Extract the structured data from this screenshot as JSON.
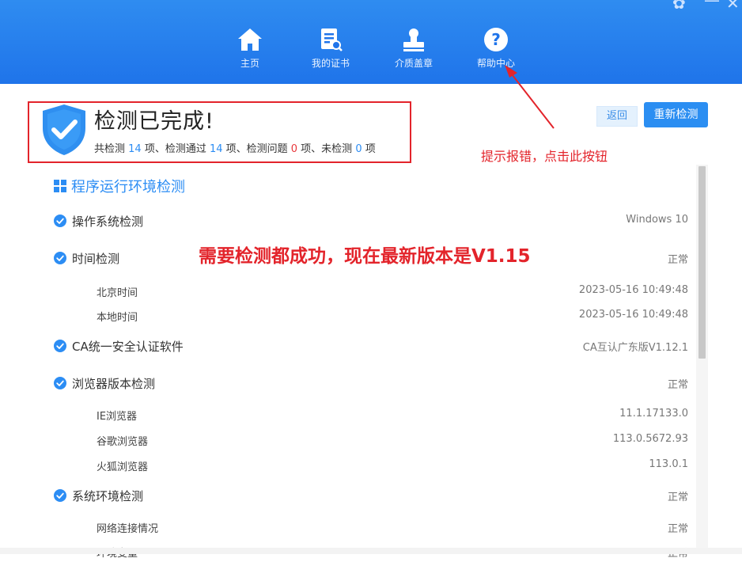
{
  "window": {
    "skin_icon": "skin-icon",
    "minimize_icon": "minimize-icon",
    "close_icon": "close-icon"
  },
  "nav": {
    "items": [
      {
        "label": "主页",
        "icon": "home-icon"
      },
      {
        "label": "我的证书",
        "icon": "certificate-icon"
      },
      {
        "label": "介质盖章",
        "icon": "stamp-icon"
      },
      {
        "label": "帮助中心",
        "icon": "help-icon"
      }
    ]
  },
  "result": {
    "title": "检测已完成!",
    "summary": {
      "p1": "共检测 ",
      "total": "14",
      "p2": " 项、检测通过 ",
      "passed": "14",
      "p3": " 项、检测问题 ",
      "issues": "0",
      "p4": " 项、未检测 ",
      "unchecked": "0",
      "p5": " 项"
    }
  },
  "buttons": {
    "back": "返回",
    "recheck": "重新检测"
  },
  "annotations": {
    "help_tip": "提示报错，点击此按钮",
    "version_note": "需要检测都成功，现在最新版本是V1.15"
  },
  "section": {
    "title": "程序运行环境检测"
  },
  "checks": [
    {
      "name": "操作系统检测",
      "value": "Windows 10",
      "main": true
    },
    {
      "name": "时间检测",
      "value": "正常",
      "main": true
    },
    {
      "name": "北京时间",
      "value": "2023-05-16 10:49:48",
      "main": false
    },
    {
      "name": "本地时间",
      "value": "2023-05-16 10:49:48",
      "main": false
    },
    {
      "name": "CA统一安全认证软件",
      "value": "CA互认广东版V1.12.1",
      "main": true
    },
    {
      "name": "浏览器版本检测",
      "value": "正常",
      "main": true
    },
    {
      "name": "IE浏览器",
      "value": "11.1.17133.0",
      "main": false
    },
    {
      "name": "谷歌浏览器",
      "value": "113.0.5672.93",
      "main": false
    },
    {
      "name": "火狐浏览器",
      "value": "113.0.1",
      "main": false
    },
    {
      "name": "系统环境检测",
      "value": "正常",
      "main": true
    },
    {
      "name": "网络连接情况",
      "value": "正常",
      "main": false
    },
    {
      "name": "环境变量",
      "value": "正常",
      "main": false
    }
  ],
  "colors": {
    "header_blue": "#1f74ea",
    "accent_blue": "#2c8df4",
    "alert_red": "#e3242b"
  }
}
